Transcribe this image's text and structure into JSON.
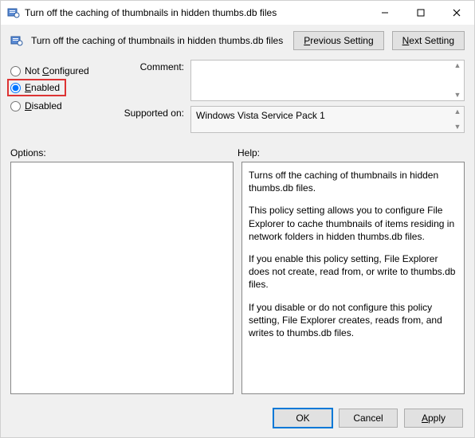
{
  "window": {
    "title": "Turn off the caching of thumbnails in hidden thumbs.db files"
  },
  "header": {
    "title": "Turn off the caching of thumbnails in hidden thumbs.db files",
    "prev_prefix": "P",
    "prev_rest": "revious Setting",
    "next_prefix": "N",
    "next_rest": "ext Setting"
  },
  "state": {
    "not_configured_prefix": "C",
    "not_configured_label": "Not ",
    "not_configured_rest": "onfigured",
    "enabled_prefix": "E",
    "enabled_rest": "nabled",
    "disabled_prefix": "D",
    "disabled_rest": "isabled",
    "selected": "enabled"
  },
  "fields": {
    "comment_label": "Comment:",
    "comment_value": "",
    "supported_label": "Supported on:",
    "supported_value": "Windows Vista Service Pack 1"
  },
  "sections": {
    "options_label": "Options:",
    "help_label": "Help:"
  },
  "help": {
    "p1": "Turns off the caching of thumbnails in hidden thumbs.db files.",
    "p2": "This policy setting allows you to configure File Explorer to cache thumbnails of items residing in network folders in hidden thumbs.db files.",
    "p3": "If you enable this policy setting, File Explorer does not create, read from, or write to thumbs.db files.",
    "p4": "If you disable or do not configure this policy setting, File Explorer creates, reads from, and writes to thumbs.db files."
  },
  "footer": {
    "ok": "OK",
    "cancel": "Cancel",
    "apply_prefix": "A",
    "apply_rest": "pply"
  }
}
